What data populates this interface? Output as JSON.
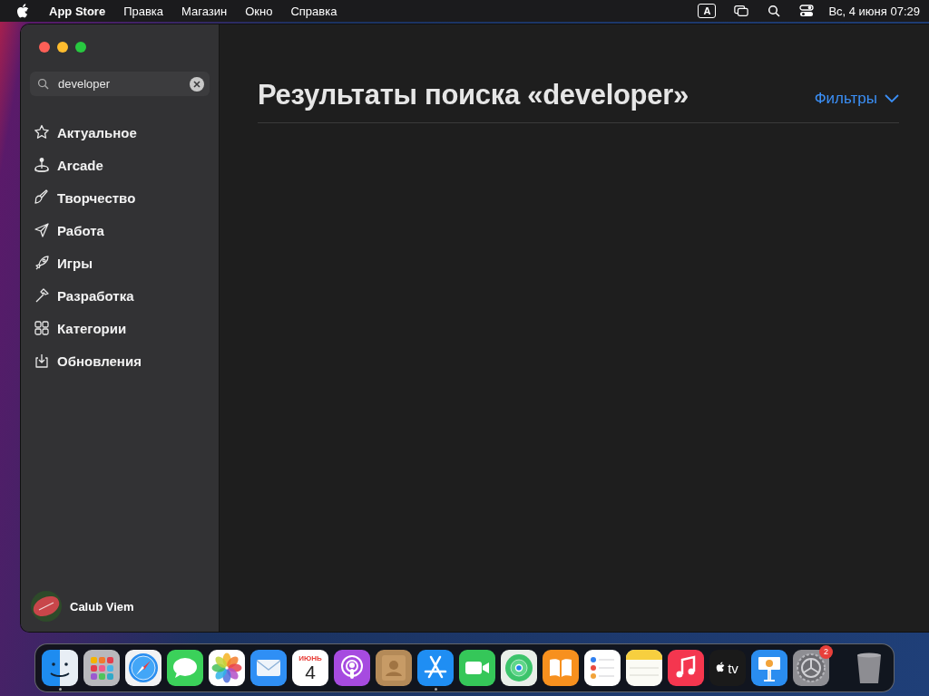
{
  "menu_bar": {
    "app_name": "App Store",
    "menus": [
      "Правка",
      "Магазин",
      "Окно",
      "Справка"
    ],
    "input_indicator": "A",
    "clock": "Вс, 4 июня 07:29"
  },
  "sidebar": {
    "search": {
      "value": "developer"
    },
    "items": [
      {
        "label": "Актуальное",
        "selected": false
      },
      {
        "label": "Arcade",
        "selected": false
      },
      {
        "label": "Творчество",
        "selected": false
      },
      {
        "label": "Работа",
        "selected": false
      },
      {
        "label": "Игры",
        "selected": false
      },
      {
        "label": "Разработка",
        "selected": false
      },
      {
        "label": "Категории",
        "selected": false
      },
      {
        "label": "Обновления",
        "selected": false
      }
    ],
    "account": {
      "name": "Calub Viem"
    }
  },
  "main": {
    "title": "Результаты поиска «developer»",
    "filter_button": "Фильтры"
  },
  "dock": {
    "apps": [
      {
        "kind": "finder",
        "running": true
      },
      {
        "kind": "launchpad",
        "running": false
      },
      {
        "kind": "safari",
        "running": false
      },
      {
        "kind": "messages",
        "running": false
      },
      {
        "kind": "photos",
        "running": false
      },
      {
        "kind": "mail",
        "running": false
      },
      {
        "kind": "calendar",
        "running": false,
        "month": "ИЮНЬ",
        "day": "4"
      },
      {
        "kind": "podcasts",
        "running": false
      },
      {
        "kind": "contacts",
        "running": false
      },
      {
        "kind": "appstore",
        "running": true
      },
      {
        "kind": "facetime",
        "running": false
      },
      {
        "kind": "findmy",
        "running": false
      },
      {
        "kind": "books",
        "running": false
      },
      {
        "kind": "reminders",
        "running": false
      },
      {
        "kind": "notes",
        "running": false
      },
      {
        "kind": "music",
        "running": false
      },
      {
        "kind": "tv",
        "running": false,
        "label": "tv"
      },
      {
        "kind": "keynote",
        "running": false
      },
      {
        "kind": "settings",
        "running": false,
        "badge": "2"
      }
    ],
    "trash": {
      "running": false
    }
  }
}
